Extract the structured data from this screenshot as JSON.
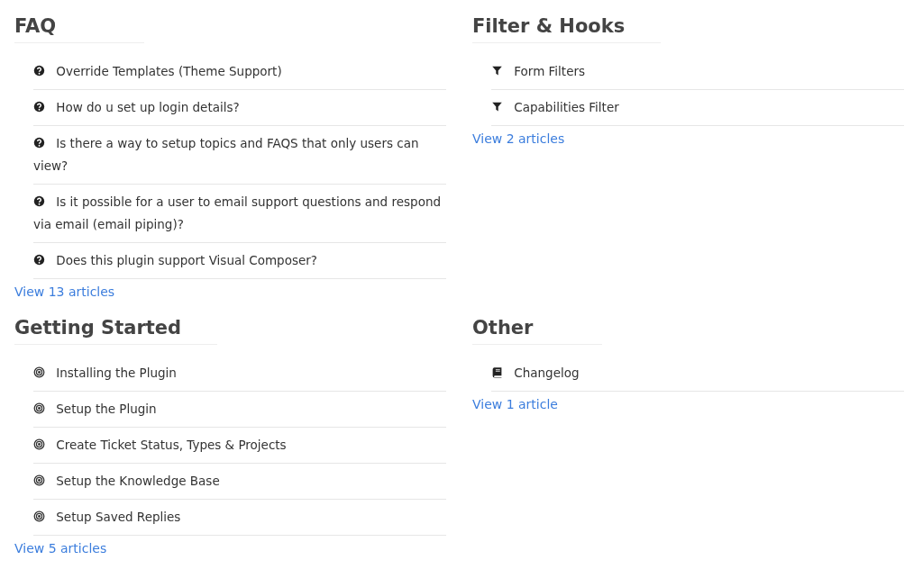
{
  "sections": [
    {
      "title": "FAQ",
      "kind": "question",
      "articles": [
        "Override Templates (Theme Support)",
        "How do u set up login details?",
        "Is there a way to setup topics and FAQS that only users can view?",
        "Is it possible for a user to email support questions and respond via email (email piping)?",
        "Does this plugin support Visual Composer?"
      ],
      "link": "View 13 articles"
    },
    {
      "title": "Filter & Hooks",
      "kind": "filter",
      "articles": [
        "Form Filters",
        "Capabilities Filter"
      ],
      "link": "View 2 articles"
    },
    {
      "title": "Getting Started",
      "kind": "target",
      "articles": [
        "Installing the Plugin",
        "Setup the Plugin",
        "Create Ticket Status, Types & Projects",
        "Setup the Knowledge Base",
        "Setup Saved Replies"
      ],
      "link": "View 5 articles"
    },
    {
      "title": "Other",
      "kind": "book",
      "articles": [
        "Changelog"
      ],
      "link": "View 1 article"
    }
  ]
}
